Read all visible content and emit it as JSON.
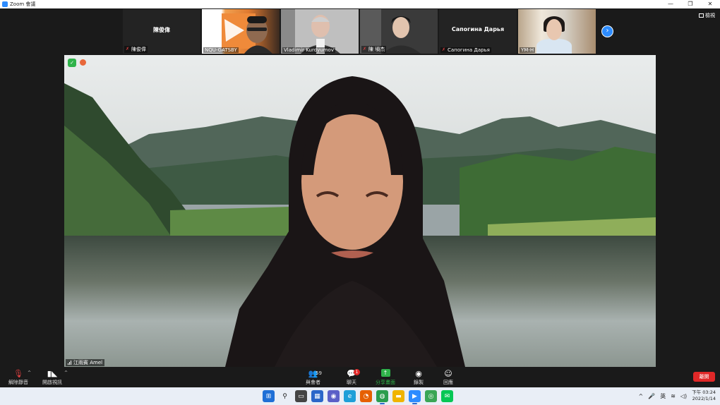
{
  "window": {
    "title": "Zoom 會議",
    "minimize": "—",
    "restore": "❐",
    "close": "✕"
  },
  "gallery": {
    "view_label": "檢視",
    "next_label": "›",
    "tiles": [
      {
        "center_name": "陳俊偉",
        "tag": "陳俊偉",
        "muted": true,
        "video": false
      },
      {
        "center_name": "",
        "tag": "NQU-GATSBY",
        "muted": false,
        "video": true
      },
      {
        "center_name": "",
        "tag": "Vladimir Kurdyumov",
        "muted": false,
        "video": true
      },
      {
        "center_name": "",
        "tag": "陳 塤杰",
        "muted": true,
        "video": true
      },
      {
        "center_name": "Сапогина Дарья",
        "tag": "Сапогина Дарья",
        "muted": true,
        "video": false
      },
      {
        "center_name": "",
        "tag": "YM-H",
        "muted": false,
        "video": true
      }
    ]
  },
  "speaker": {
    "name": "江雨賓 Amel"
  },
  "toolbar": {
    "mute_label": "解除靜音",
    "video_label": "開啟視訊",
    "participants_label": "與會者",
    "participants_count": "59",
    "chat_label": "聊天",
    "chat_badge": "1",
    "share_label": "分享畫面",
    "record_label": "錄製",
    "reactions_label": "回應",
    "end_label": "離開"
  },
  "taskbar": {
    "ime": "英",
    "time": "下午 03:24",
    "date": "2022/1/14"
  },
  "colors": {
    "accent": "#2d8cff",
    "share_green": "#2fb34a",
    "end_red": "#e02828"
  }
}
